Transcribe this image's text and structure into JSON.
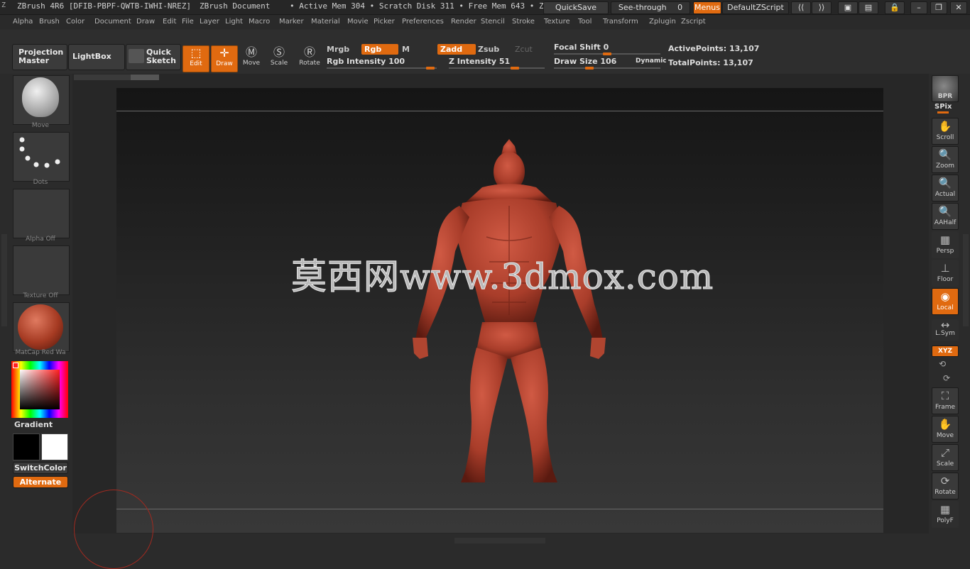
{
  "title_bar": {
    "app_title": "ZBrush 4R6 [DFIB-PBPF-QWTB-IWHI-NREZ]",
    "document": "ZBrush Document",
    "mem_info": "• Active Mem 304 • Scratch Disk 311 • Free Mem 643 • Z",
    "quicksave": "QuickSave",
    "see_through": "See-through",
    "see_through_value": "0",
    "menus": "Menus",
    "default_zscript": "DefaultZScript"
  },
  "menu_items": [
    "Alpha",
    "Brush",
    "Color",
    "Document",
    "Draw",
    "Edit",
    "File",
    "Layer",
    "Light",
    "Macro",
    "Marker",
    "Material",
    "Movie",
    "Picker",
    "Preferences",
    "Render",
    "Stencil",
    "Stroke",
    "Texture",
    "Tool",
    "Transform",
    "Zplugin",
    "Zscript"
  ],
  "toolbar": {
    "projection_master": "Projection Master",
    "lightbox": "LightBox",
    "quick_sketch": "Quick Sketch",
    "edit": "Edit",
    "draw": "Draw",
    "move": "Move",
    "scale": "Scale",
    "rotate": "Rotate",
    "mrgb": "Mrgb",
    "rgb": "Rgb",
    "m": "M",
    "zadd": "Zadd",
    "zsub": "Zsub",
    "zcut": "Zcut",
    "rgb_intensity": "Rgb Intensity 100",
    "z_intensity": "Z Intensity 51",
    "focal_shift": "Focal Shift 0",
    "draw_size": "Draw Size 106",
    "dynamic": "Dynamic",
    "active_points": "ActivePoints: 13,107",
    "total_points": "TotalPoints: 13,107"
  },
  "left_panel": {
    "brush_label": "Move",
    "stroke_label": "Dots",
    "alpha_label": "Alpha Off",
    "texture_label": "Texture Off",
    "material_label": "MatCap Red Wa",
    "gradient": "Gradient",
    "switch_color": "SwitchColor",
    "alternate": "Alternate"
  },
  "canvas": {
    "watermark": "莫西网www.3dmox.com"
  },
  "right_shelf": {
    "bpr": "BPR",
    "spix": "SPix",
    "scroll": "Scroll",
    "zoom": "Zoom",
    "actual": "Actual",
    "aahalf": "AAHalf",
    "persp": "Persp",
    "floor": "Floor",
    "local": "Local",
    "lsym": "L.Sym",
    "xyz": "XYZ",
    "frame": "Frame",
    "move": "Move",
    "scale": "Scale",
    "rotate": "Rotate",
    "polyf": "PolyF"
  },
  "colors": {
    "accent": "#e06a10",
    "model": "#b8432f",
    "background": "#2b2b2b"
  }
}
